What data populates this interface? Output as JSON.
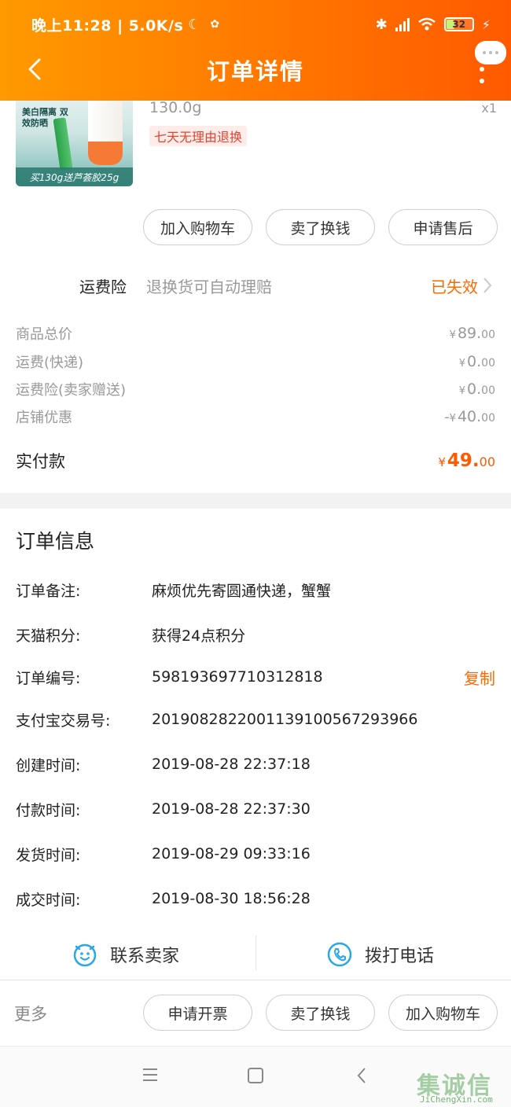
{
  "status_bar": {
    "time_speed": "晚上11:28 | 5.0K/s",
    "battery": "32"
  },
  "header": {
    "title": "订单详情"
  },
  "product": {
    "image_text_top": "美白隔离 双效防晒",
    "image_caption": "买130g送芦荟胶25g",
    "weight": "130.0g",
    "quantity": "x1",
    "tag": "七天无理由退换"
  },
  "item_actions": [
    "加入购物车",
    "卖了换钱",
    "申请售后"
  ],
  "insurance": {
    "label": "运费险",
    "desc": "退换货可自动理赔",
    "status": "已失效"
  },
  "prices": [
    {
      "label": "商品总价",
      "prefix": "",
      "yen": "¥",
      "int": "89.",
      "dec": "00"
    },
    {
      "label": "运费(快递)",
      "prefix": "",
      "yen": "¥",
      "int": "0.",
      "dec": "00"
    },
    {
      "label": "运费险(卖家赠送)",
      "prefix": "",
      "yen": "¥",
      "int": "0.",
      "dec": "00"
    },
    {
      "label": "店铺优惠",
      "prefix": "-",
      "yen": "¥",
      "int": "40.",
      "dec": "00"
    }
  ],
  "paid": {
    "label": "实付款",
    "yen": "¥",
    "int": "49.",
    "dec": "00"
  },
  "order_info": {
    "title": "订单信息",
    "rows": [
      {
        "k": "订单备注:",
        "v": "麻烦优先寄圆通快递，蟹蟹"
      },
      {
        "k": "天猫积分:",
        "v": "获得24点积分"
      },
      {
        "k": "订单编号:",
        "v": "598193697710312818",
        "action": "复制"
      },
      {
        "k": "支付宝交易号:",
        "v": "2019082822001139100567293966"
      },
      {
        "k": "创建时间:",
        "v": "2019-08-28 22:37:18"
      },
      {
        "k": "付款时间:",
        "v": "2019-08-28 22:37:30"
      },
      {
        "k": "发货时间:",
        "v": "2019-08-29 09:33:16"
      },
      {
        "k": "成交时间:",
        "v": "2019-08-30 18:56:28"
      }
    ]
  },
  "contact": {
    "seller": "联系卖家",
    "phone": "拨打电话"
  },
  "bottom_bar": {
    "more": "更多",
    "buttons": [
      "申请开票",
      "卖了换钱",
      "加入购物车"
    ]
  },
  "watermark": {
    "big": "集诚信",
    "small": "JiChengXin.com"
  },
  "colors": {
    "accent": "#ff6a00",
    "header_start": "#ff9a00",
    "header_end": "#ff5a00",
    "contact_icon": "#2aa7e6"
  }
}
